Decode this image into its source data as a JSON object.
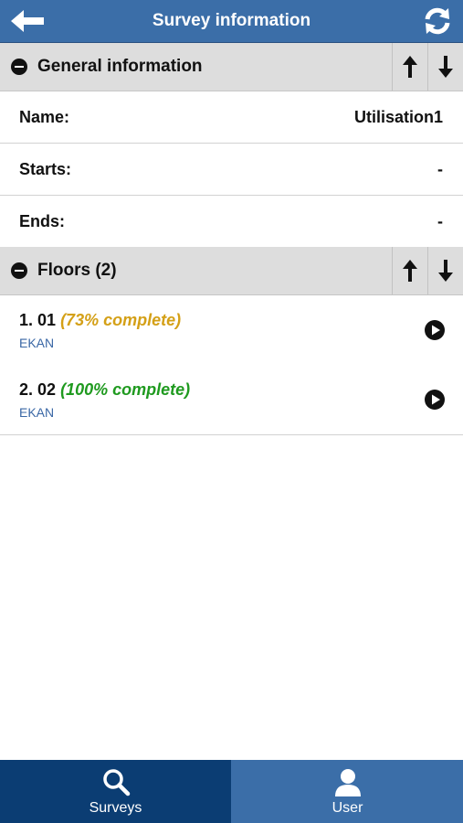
{
  "header": {
    "title": "Survey information",
    "back_icon": "left-arrow-icon",
    "refresh_icon": "refresh-icon"
  },
  "general": {
    "title": "General information",
    "rows": [
      {
        "label": "Name:",
        "value": "Utilisation1"
      },
      {
        "label": "Starts:",
        "value": "-"
      },
      {
        "label": "Ends:",
        "value": "-"
      }
    ]
  },
  "floors": {
    "title": "Floors (2)",
    "items": [
      {
        "number": "1. 01",
        "progress": "(73% complete)",
        "progress_color": "#d4a017",
        "subtitle": "EKAN"
      },
      {
        "number": "2. 02",
        "progress": "(100% complete)",
        "progress_color": "#1f9a1f",
        "subtitle": "EKAN"
      }
    ]
  },
  "tabs": [
    {
      "label": "Surveys",
      "icon": "search-icon",
      "active": true
    },
    {
      "label": "User",
      "icon": "user-icon",
      "active": false
    }
  ],
  "colors": {
    "header": "#3b6ea8",
    "tab_active": "#0b3d73",
    "section_bg": "#dddddd",
    "link": "#3a67a5"
  }
}
